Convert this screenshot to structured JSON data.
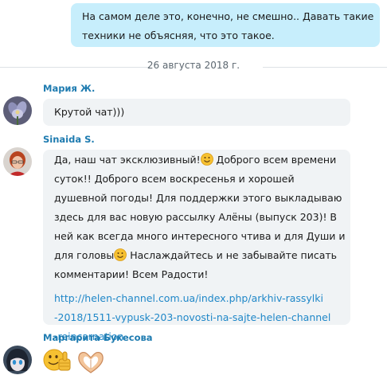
{
  "own_message": {
    "lines": [
      "На самом деле это, конечно, не смешно.. Давать такие",
      "техники не объясняя, что это такое."
    ]
  },
  "date_divider": "26 августа 2018 г.",
  "messages": [
    {
      "sender": "Мария Ж.",
      "text": "Крутой чат)))"
    },
    {
      "sender": "Sinaida S.",
      "lines": [
        {
          "before": "Да, наш чат эксклюзивный!",
          "after": " Доброго всем времени"
        },
        {
          "text": "суток!! Доброго всем воскресенья и хорошей"
        },
        {
          "text": "душевной погоды! Для поддержки этого выкладываю"
        },
        {
          "text": "здесь для вас новую рассылку Алёны (выпуск 203)! В"
        },
        {
          "text": "ней как всегда много интересного чтива и для Души и"
        },
        {
          "before": "для головы",
          "after": " Наслаждайтесь и не забывайте писать"
        },
        {
          "text": "комментарии! Всем Радости!"
        }
      ],
      "link_lines": [
        "http://helen-channel.com.ua/index.php/arkhiv-rassylki",
        "-2018/1511-vypusk-203-novosti-na-sajte-helen-channel",
        "-reincarnation"
      ]
    },
    {
      "sender": "Маргарита Букесова",
      "emoji": [
        "thumbs-up-emoji",
        "heart-hands-emoji"
      ]
    }
  ],
  "colors": {
    "own_bubble": "#c7eefc",
    "incoming_bubble": "#f0f3f5",
    "sender_name": "#1e7bb0",
    "link": "#1f87c8",
    "emoji_face": "#f6c131"
  }
}
